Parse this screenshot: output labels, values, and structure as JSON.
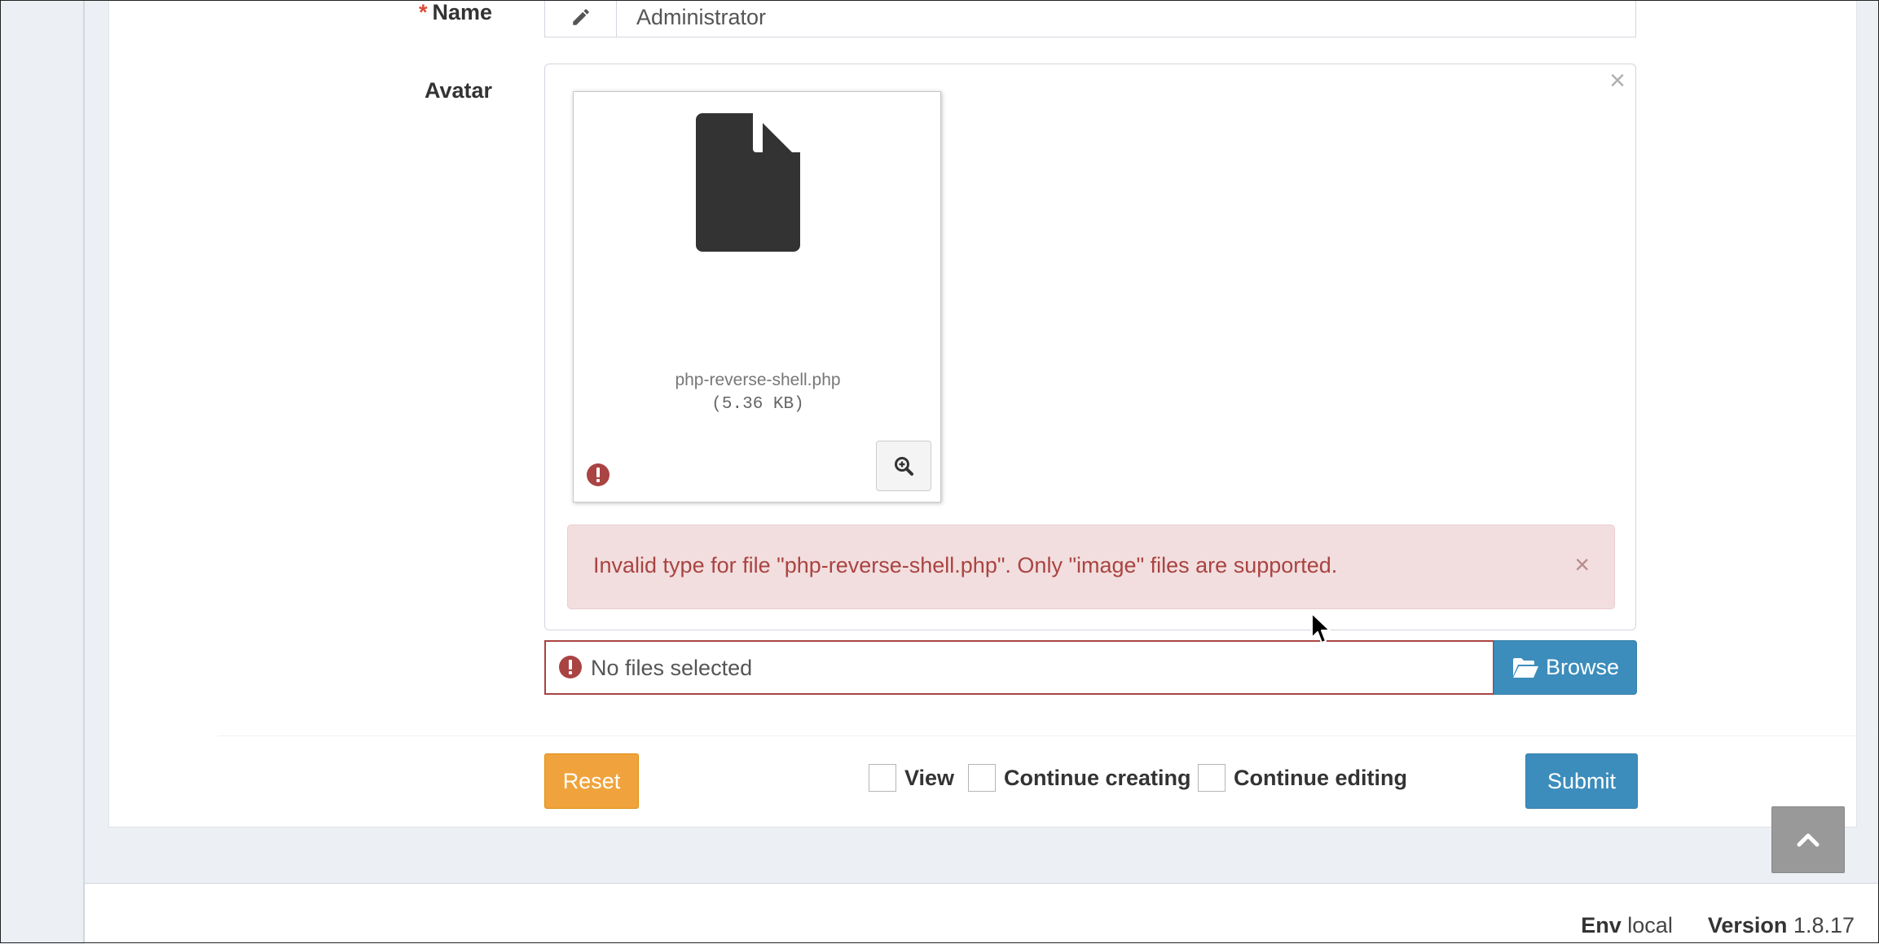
{
  "form": {
    "name_label": "Name",
    "name_required_mark": "*",
    "name_value": "Administrator",
    "avatar_label": "Avatar"
  },
  "preview": {
    "close_glyph": "×",
    "file_name": "php-reverse-shell.php",
    "file_size": "(5.36 KB)",
    "error_message": "Invalid type for file \"php-reverse-shell.php\". Only \"image\" files are supported.",
    "error_close_glyph": "×",
    "icons": [
      "file-icon",
      "error-icon",
      "zoom-icon"
    ]
  },
  "file_input": {
    "caption": "No files selected",
    "browse_label": "Browse",
    "icons": [
      "error-icon",
      "folder-open-icon"
    ]
  },
  "actions": {
    "reset_label": "Reset",
    "view_label": "View",
    "continue_creating_label": "Continue creating",
    "continue_editing_label": "Continue editing",
    "submit_label": "Submit"
  },
  "footer": {
    "env_label": "Env",
    "env_value": "local",
    "version_label": "Version",
    "version_value": "1.8.17"
  },
  "colors": {
    "primary": "#3c8dbc",
    "warning": "#f0a33c",
    "danger": "#a94442",
    "danger_bg": "#f2dede",
    "page_bg": "#ecf0f5"
  }
}
